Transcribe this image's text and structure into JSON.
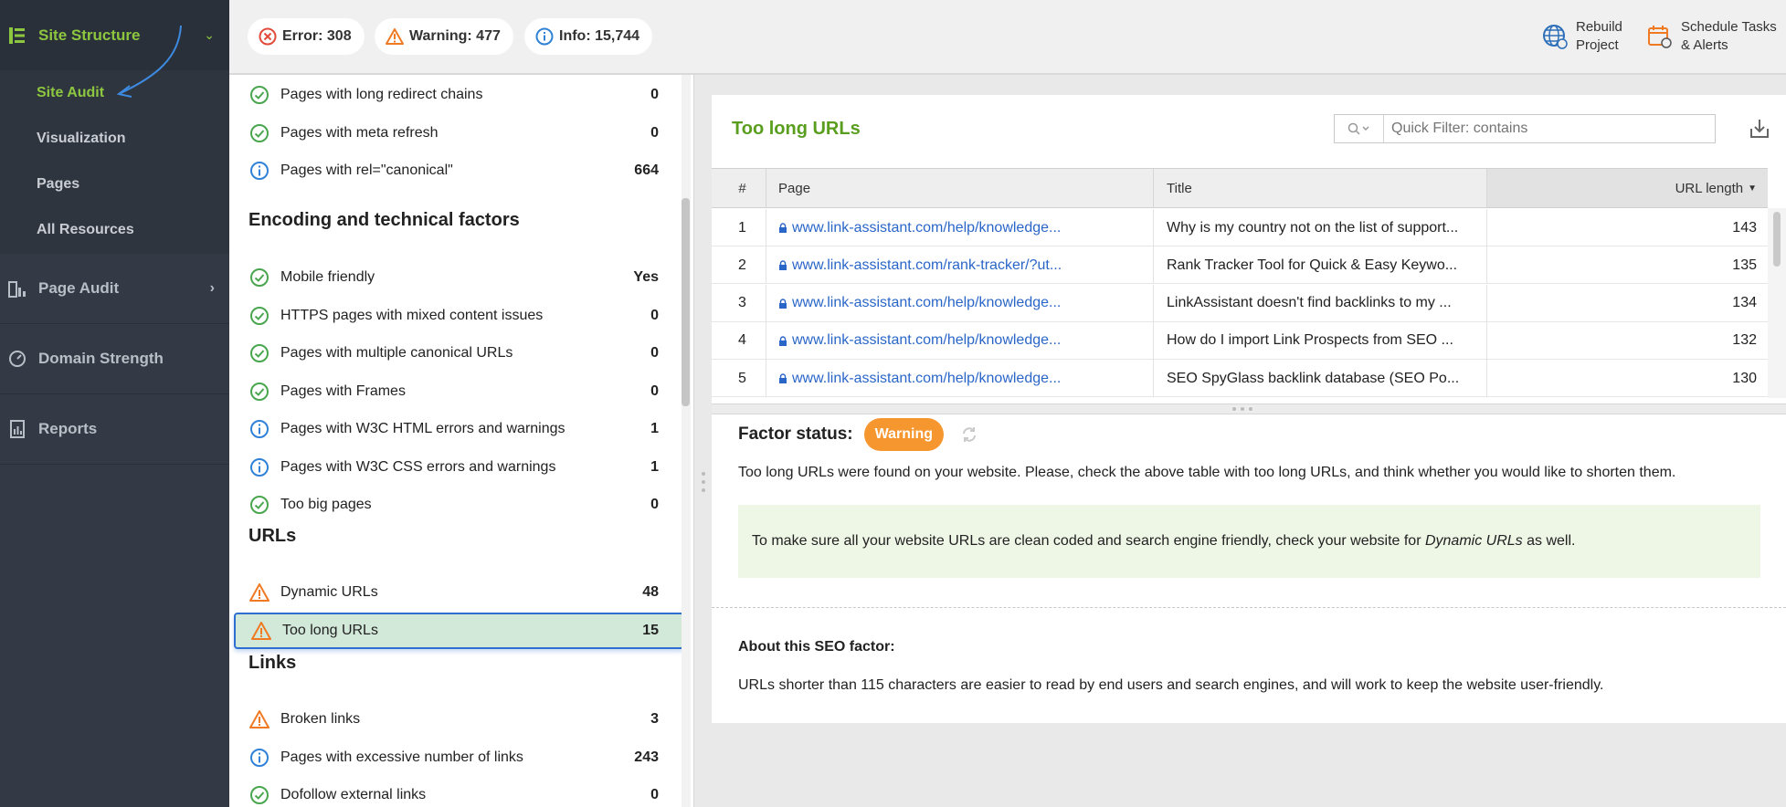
{
  "sidebar": {
    "header": {
      "label": "Site Structure"
    },
    "subitems": [
      {
        "label": "Site Audit"
      },
      {
        "label": "Visualization"
      },
      {
        "label": "Pages"
      },
      {
        "label": "All Resources"
      }
    ],
    "sections": [
      {
        "label": "Page Audit"
      },
      {
        "label": "Domain Strength"
      },
      {
        "label": "Reports"
      }
    ]
  },
  "topbar": {
    "error": "Error: 308",
    "warning": "Warning: 477",
    "info": "Info: 15,744",
    "rebuild_line1": "Rebuild",
    "rebuild_line2": "Project",
    "schedule_line1": "Schedule Tasks",
    "schedule_line2": "& Alerts"
  },
  "factors": {
    "group0": [
      {
        "status": "ok",
        "label": "Pages with long redirect chains",
        "value": "0"
      },
      {
        "status": "ok",
        "label": "Pages with meta refresh",
        "value": "0"
      },
      {
        "status": "info",
        "label": "Pages with rel=\"canonical\"",
        "value": "664"
      }
    ],
    "encoding_heading": "Encoding and technical factors",
    "encoding": [
      {
        "status": "ok",
        "label": "Mobile friendly",
        "value": "Yes"
      },
      {
        "status": "ok",
        "label": "HTTPS pages with mixed content issues",
        "value": "0"
      },
      {
        "status": "ok",
        "label": "Pages with multiple canonical URLs",
        "value": "0"
      },
      {
        "status": "ok",
        "label": "Pages with Frames",
        "value": "0"
      },
      {
        "status": "info",
        "label": "Pages with W3C HTML errors and warnings",
        "value": "1"
      },
      {
        "status": "info",
        "label": "Pages with W3C CSS errors and warnings",
        "value": "1"
      },
      {
        "status": "ok",
        "label": "Too big pages",
        "value": "0"
      }
    ],
    "urls_heading": "URLs",
    "urls": [
      {
        "status": "warn",
        "label": "Dynamic URLs",
        "value": "48"
      },
      {
        "status": "warn",
        "label": "Too long URLs",
        "value": "15"
      }
    ],
    "links_heading": "Links",
    "links": [
      {
        "status": "warn",
        "label": "Broken links",
        "value": "3"
      },
      {
        "status": "info",
        "label": "Pages with excessive number of links",
        "value": "243"
      },
      {
        "status": "ok",
        "label": "Dofollow external links",
        "value": "0"
      }
    ]
  },
  "detail": {
    "title": "Too long URLs",
    "filter_placeholder": "Quick Filter: contains",
    "columns": {
      "num": "#",
      "page": "Page",
      "title": "Title",
      "urllen": "URL length"
    },
    "rows": [
      {
        "num": "1",
        "page": "www.link-assistant.com/help/knowledge...",
        "title": "Why is my country not on the list of support...",
        "len": "143"
      },
      {
        "num": "2",
        "page": "www.link-assistant.com/rank-tracker/?ut...",
        "title": "Rank Tracker Tool for Quick & Easy Keywo...",
        "len": "135"
      },
      {
        "num": "3",
        "page": "www.link-assistant.com/help/knowledge...",
        "title": "LinkAssistant doesn't find backlinks to my ...",
        "len": "134"
      },
      {
        "num": "4",
        "page": "www.link-assistant.com/help/knowledge...",
        "title": "How do I import Link Prospects from SEO ...",
        "len": "132"
      },
      {
        "num": "5",
        "page": "www.link-assistant.com/help/knowledge...",
        "title": "SEO SpyGlass backlink database (SEO Po...",
        "len": "130"
      }
    ],
    "factor_status_label": "Factor status:",
    "factor_status_value": "Warning",
    "description": "Too long URLs were found on your website. Please, check the above table with too long URLs, and think whether you would like to shorten them.",
    "tip_before": "To make sure all your website URLs are clean coded and search engine friendly, check your website for ",
    "tip_em": "Dynamic URLs",
    "tip_after": " as well.",
    "about_heading": "About this SEO factor:",
    "about_text": "URLs shorter than 115 characters are easier to read by end users and search engines, and will work to keep the website user-friendly."
  },
  "colors": {
    "accent_green": "#8dc63f",
    "warning_orange": "#f5962e",
    "link_blue": "#2a66c8",
    "sidebar_bg": "#333a45"
  }
}
